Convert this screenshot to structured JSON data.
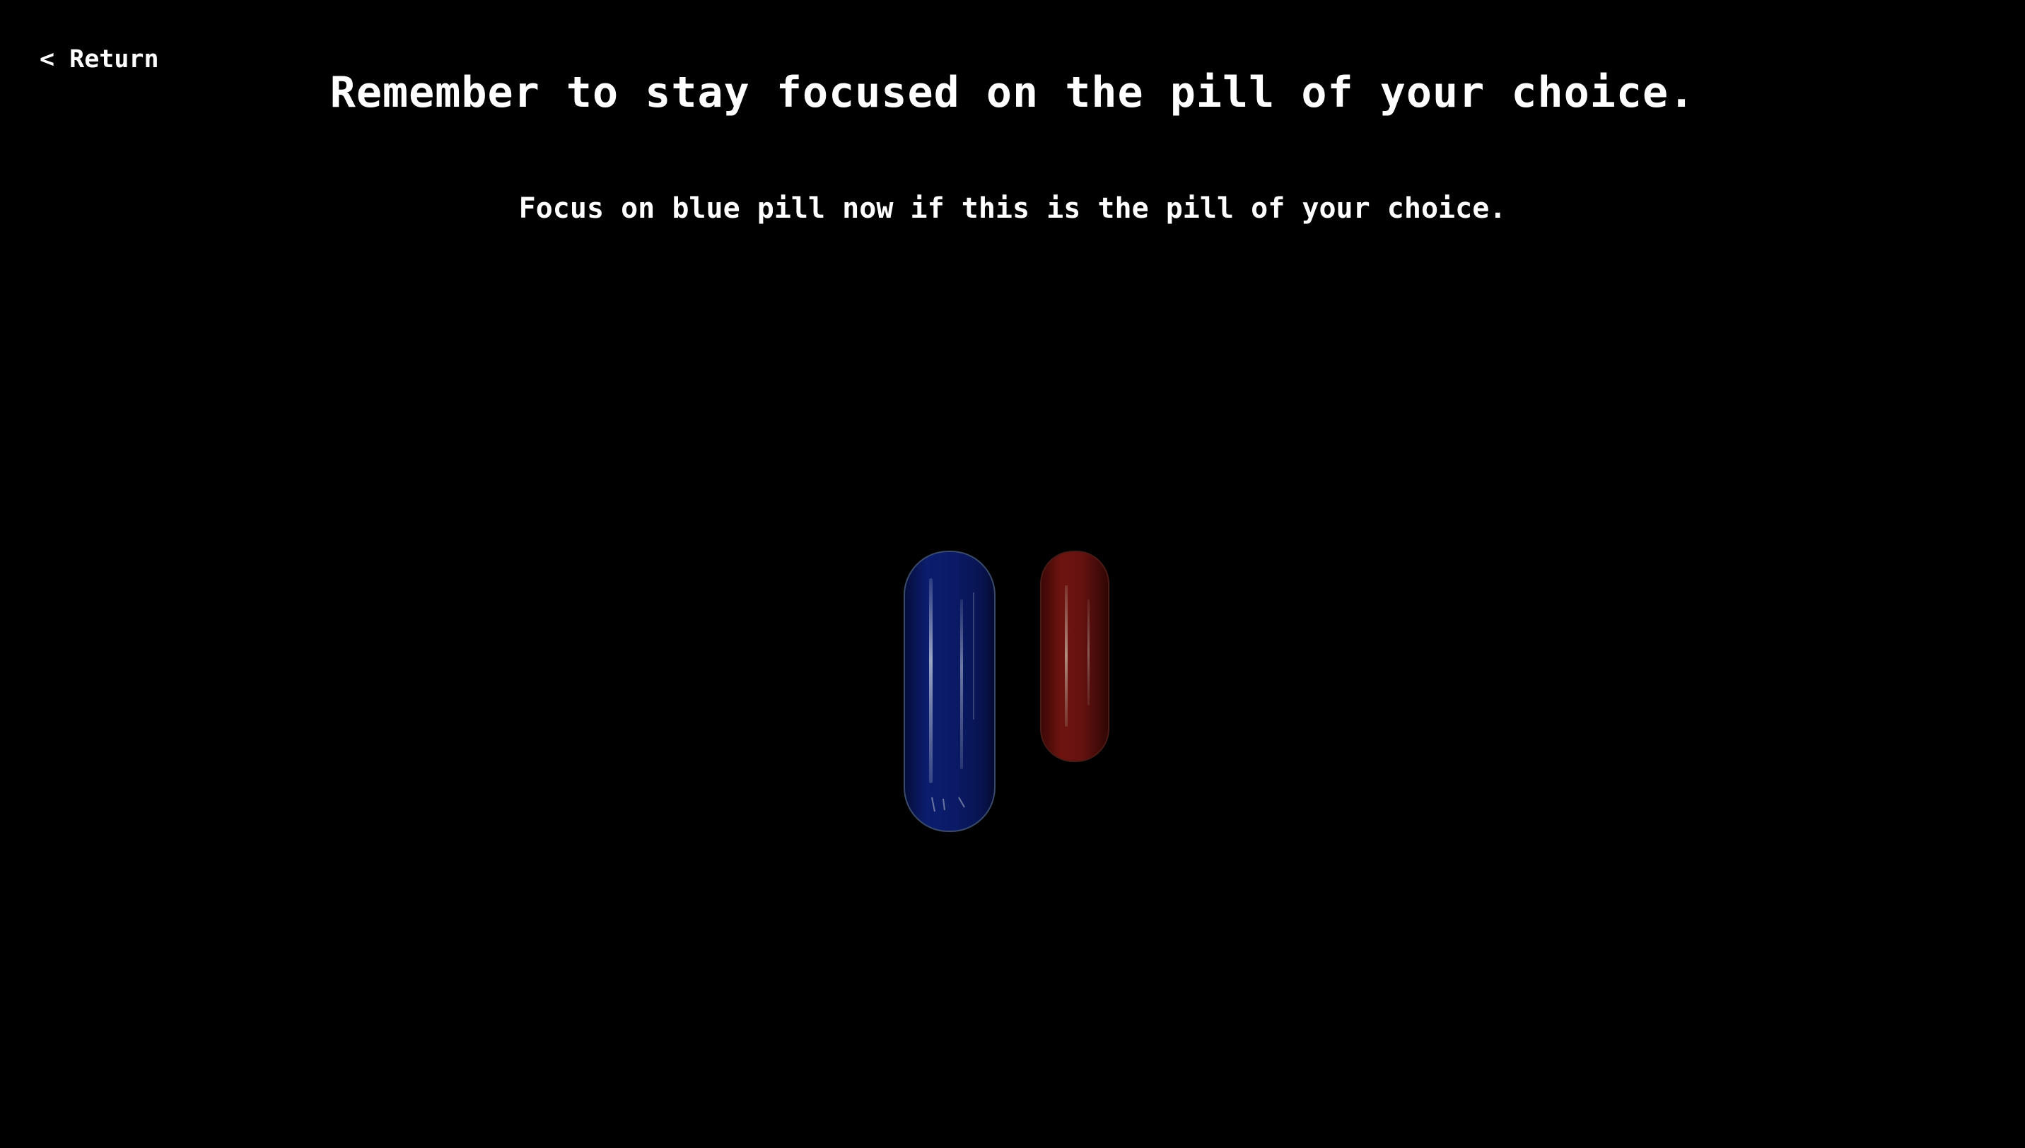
{
  "nav": {
    "return_label": "< Return"
  },
  "header": {
    "title": "Remember to stay focused on the pill of your choice."
  },
  "prompt": {
    "instruction": "Focus on blue pill now if this is the pill of your choice."
  },
  "pills": {
    "blue": {
      "color": "#0a1a66",
      "icon": "blue-pill"
    },
    "red": {
      "color": "#6e1410",
      "icon": "red-pill"
    }
  },
  "colors": {
    "background": "#000000",
    "text": "#ffffff"
  }
}
